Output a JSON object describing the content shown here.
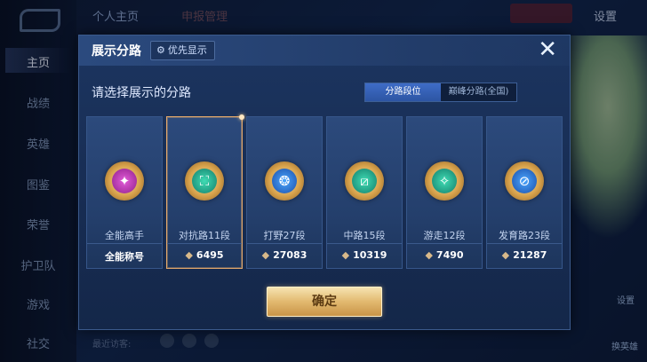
{
  "background": {
    "top_tabs": [
      "个人主页",
      "申报管理"
    ],
    "settings_label": "设置",
    "nav_items": [
      {
        "label": "主页"
      },
      {
        "label": "战绩"
      },
      {
        "label": "英雄"
      },
      {
        "label": "图鉴"
      },
      {
        "label": "荣誉"
      },
      {
        "label": "护卫队"
      },
      {
        "label": "游戏"
      },
      {
        "label": "社交"
      }
    ],
    "bottom_text": "最近访客:",
    "right_labels": [
      "设置",
      "换英雄"
    ]
  },
  "dialog": {
    "title": "展示分路",
    "priority_label": "优先显示",
    "close_glyph": "✕",
    "subtitle": "请选择展示的分路",
    "modes": [
      {
        "label": "分路段位",
        "active": true
      },
      {
        "label": "巅峰分路(全国)",
        "active": false
      }
    ],
    "cards": [
      {
        "name": "全能高手",
        "score": "全能称号",
        "show_diamond": false,
        "emblem": "pink",
        "icon": "✦",
        "icon_name": "all-round-emblem-icon"
      },
      {
        "name": "对抗路11段",
        "score": "6495",
        "show_diamond": true,
        "emblem": "teal",
        "icon": "⛶",
        "icon_name": "clash-lane-emblem-icon",
        "selected": true
      },
      {
        "name": "打野27段",
        "score": "27083",
        "show_diamond": true,
        "emblem": "blue",
        "icon": "❂",
        "icon_name": "jungle-emblem-icon"
      },
      {
        "name": "中路15段",
        "score": "10319",
        "show_diamond": true,
        "emblem": "teal",
        "icon": "⧄",
        "icon_name": "mid-lane-emblem-icon"
      },
      {
        "name": "游走12段",
        "score": "7490",
        "show_diamond": true,
        "emblem": "teal",
        "icon": "✧",
        "icon_name": "roam-emblem-icon"
      },
      {
        "name": "发育路23段",
        "score": "21287",
        "show_diamond": true,
        "emblem": "blue",
        "icon": "⊘",
        "icon_name": "farm-lane-emblem-icon"
      }
    ],
    "confirm_label": "确定"
  },
  "colors": {
    "accent_gold": "#e2b96f",
    "selected_border": "#e3a86b",
    "toggle_active": "#3e6cc7"
  }
}
